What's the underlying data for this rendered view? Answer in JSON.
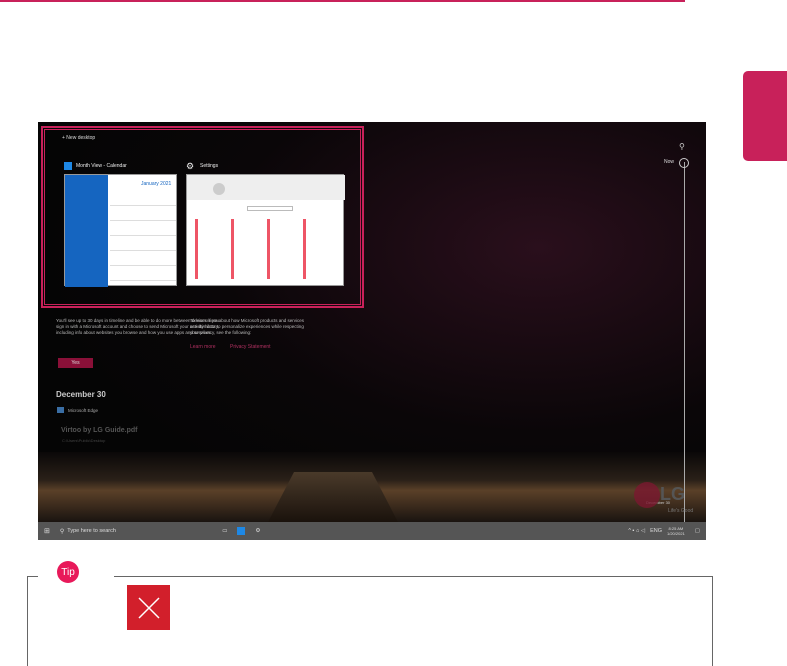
{
  "screenshot": {
    "new_desktop": "+ New desktop",
    "windows": [
      {
        "title": "Month View - Calendar",
        "month": "January 2021"
      },
      {
        "title": "Settings"
      }
    ],
    "now_label": "Now",
    "privacy": {
      "left_text": "You'll see up to 30 days in timeline and be able to do more between devices if you sign in with a Microsoft account and choose to send Microsoft your activity history, including info about websites you browse and how you use apps and services.",
      "right_text": "To learn more about how Microsoft products and services use this data to personalize experiences while respecting your privacy, see the following:",
      "yes": "Yes",
      "learn_more": "Learn more",
      "privacy_statement": "Privacy Statement"
    },
    "date_heading": "December 30",
    "app_label": "Microsoft Edge",
    "activity_title": "Virtoo by LG Guide.pdf",
    "activity_sub": "C:\\Users\\Public\\Desktop",
    "timeline_date": "December 30",
    "lg_logo": "LG",
    "lg_tagline": "Life's Good",
    "taskbar": {
      "search_placeholder": "Type here to search",
      "lang": "ENG",
      "time": "8:25 AM",
      "date": "1/20/2021"
    }
  },
  "tip": {
    "badge": "Tip"
  },
  "colors": {
    "accent": "#c8215a",
    "tip": "#e8195a",
    "close": "#d21f2b"
  }
}
